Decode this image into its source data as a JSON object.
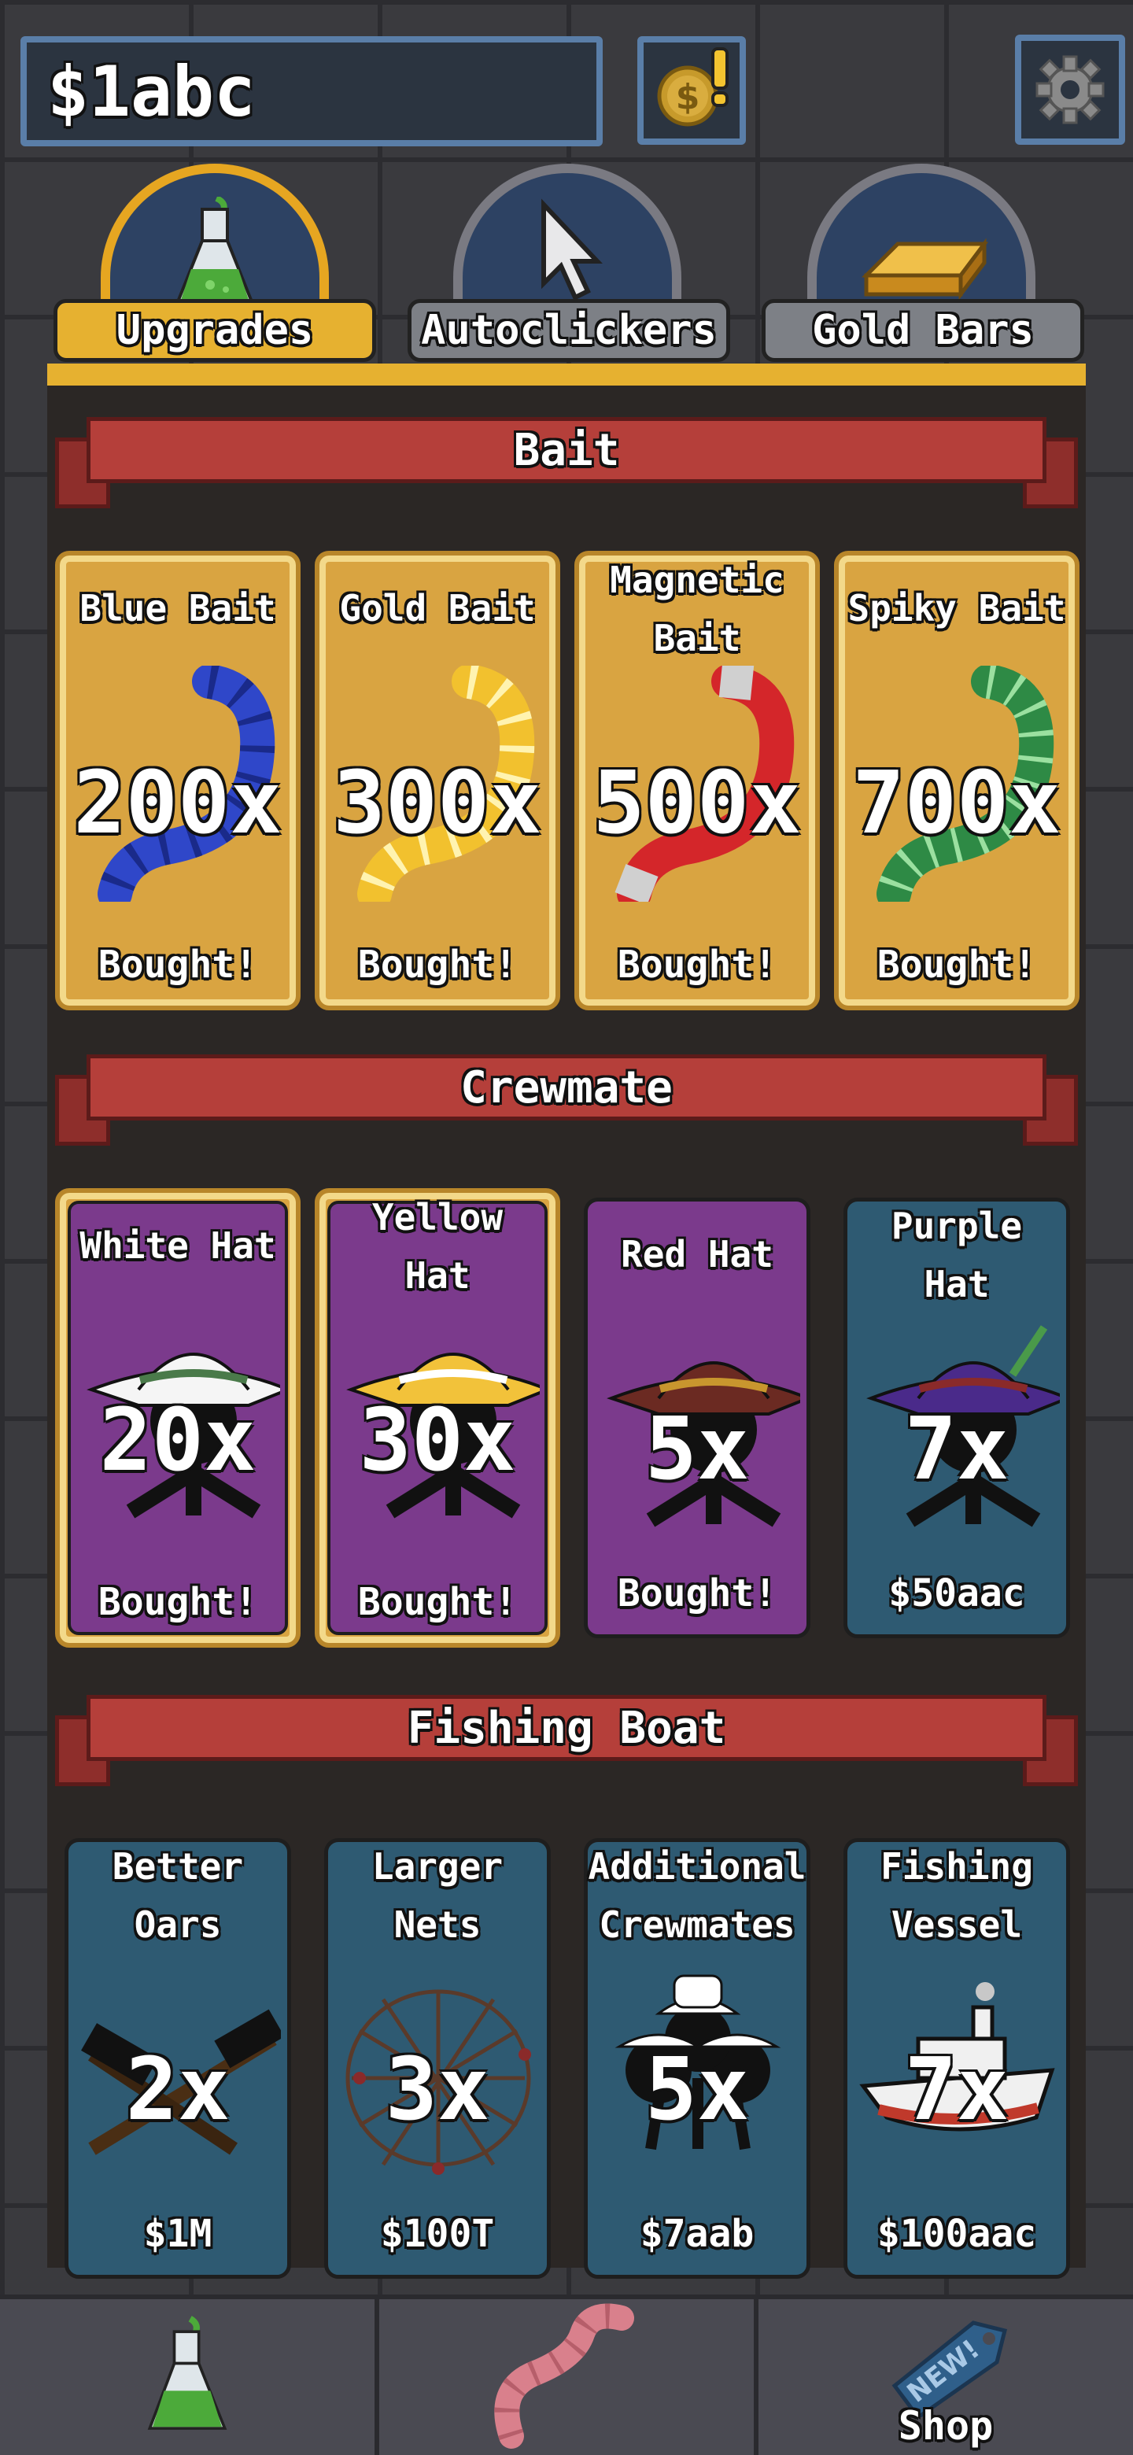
{
  "header": {
    "money": "$1abc",
    "coin_icon": "dollar-coin-icon",
    "alert_icon": "exclamation-icon",
    "settings_icon": "gear-icon"
  },
  "tabs": [
    {
      "label": "Upgrades",
      "icon": "potion-flask-icon",
      "active": true
    },
    {
      "label": "Autoclickers",
      "icon": "cursor-icon",
      "active": false
    },
    {
      "label": "Gold Bars",
      "icon": "gold-bar-icon",
      "active": false
    }
  ],
  "sections": [
    {
      "title": "Bait",
      "cards": [
        {
          "name": "Blue Bait",
          "multiplier": "200x",
          "status": "Bought!",
          "color": "#2f47c9"
        },
        {
          "name": "Gold Bait",
          "multiplier": "300x",
          "status": "Bought!",
          "color": "#f2c12e"
        },
        {
          "name": "Magnetic Bait",
          "multiplier": "500x",
          "status": "Bought!",
          "color": "#d4262a"
        },
        {
          "name": "Spiky Bait",
          "multiplier": "700x",
          "status": "Bought!",
          "color": "#2e8a45"
        }
      ]
    },
    {
      "title": "Crewmate",
      "cards": [
        {
          "name": "White Hat",
          "multiplier": "20x",
          "status": "Bought!",
          "color": "#f5f5f5"
        },
        {
          "name": "Yellow Hat",
          "multiplier": "30x",
          "status": "Bought!",
          "color": "#f2c23a"
        },
        {
          "name": "Red Hat",
          "multiplier": "5x",
          "status": "Bought!",
          "color": "#6b2a22"
        },
        {
          "name": "Purple Hat",
          "multiplier": "7x",
          "status": "$50aac",
          "color": "#4a2a8a"
        }
      ]
    },
    {
      "title": "Fishing Boat",
      "cards": [
        {
          "name": "Better Oars",
          "multiplier": "2x",
          "status": "$1M"
        },
        {
          "name": "Larger Nets",
          "multiplier": "3x",
          "status": "$100T"
        },
        {
          "name": "Additional Crewmates",
          "multiplier": "5x",
          "status": "$7aab"
        },
        {
          "name": "Fishing Vessel",
          "multiplier": "7x",
          "status": "$100aac"
        }
      ]
    }
  ],
  "bottom_nav": [
    {
      "icon": "potion-flask-icon"
    },
    {
      "icon": "worm-icon"
    },
    {
      "icon": "new-tag-icon",
      "label": "Shop",
      "tag": "NEW!"
    }
  ],
  "colors": {
    "accent_gold": "#e6b130",
    "banner_red": "#b53f3a",
    "card_purple": "#7b3a8c",
    "card_blue": "#2e5a72"
  }
}
